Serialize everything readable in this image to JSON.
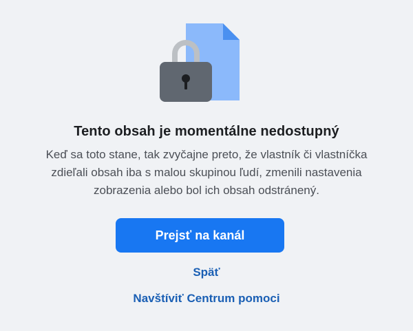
{
  "illustration": {
    "icon": "locked-document-icon",
    "colors": {
      "document": "#8bb9fb",
      "document_fold": "#4a90f0",
      "lock_body": "#606770",
      "shackle": "#bcc0c4"
    }
  },
  "message": {
    "title": "Tento obsah je momentálne nedostupný",
    "description": "Keď sa toto stane, tak zvyčajne preto, že vlastník či vlastníčka zdieľali obsah iba s malou skupinou ľudí, zmenili nastavenia zobrazenia alebo bol ich obsah odstránený."
  },
  "actions": {
    "primary_label": "Prejsť na kanál",
    "back_label": "Späť",
    "help_label": "Navštíviť Centrum pomoci"
  },
  "colors": {
    "background": "#f0f2f5",
    "primary_button": "#1877f2",
    "link": "#1a5fb4"
  }
}
